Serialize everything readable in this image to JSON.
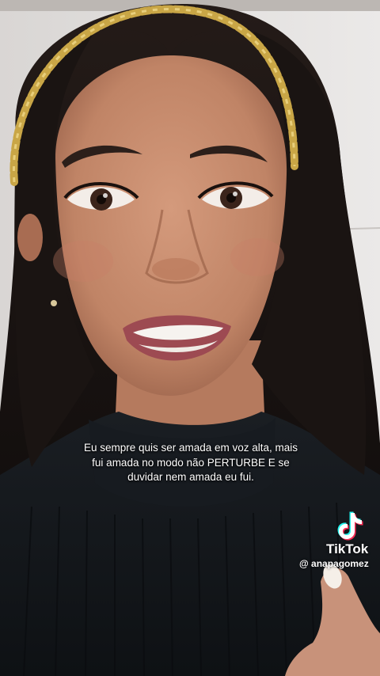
{
  "video": {
    "caption_lines": [
      "Eu sempre quis ser amada em voz alta, mais",
      "fui amada no modo não PERTURBE E se",
      "duvidar nem amada eu fui."
    ]
  },
  "watermark": {
    "brand": "TikTok",
    "username": "@ anapagomez",
    "logo_icon": "tiktok-logo-icon",
    "colors": {
      "cyan": "#25F4EE",
      "red": "#FE2C55"
    }
  },
  "scene": {
    "subject_icon": "woman-face-icon",
    "colors": {
      "wall": "#e2dfdd",
      "hair": "#1c1614",
      "skin": "#c48a6e",
      "sweater": "#14181c",
      "headband": "#c9a646",
      "lips": "#9d4a52"
    }
  }
}
